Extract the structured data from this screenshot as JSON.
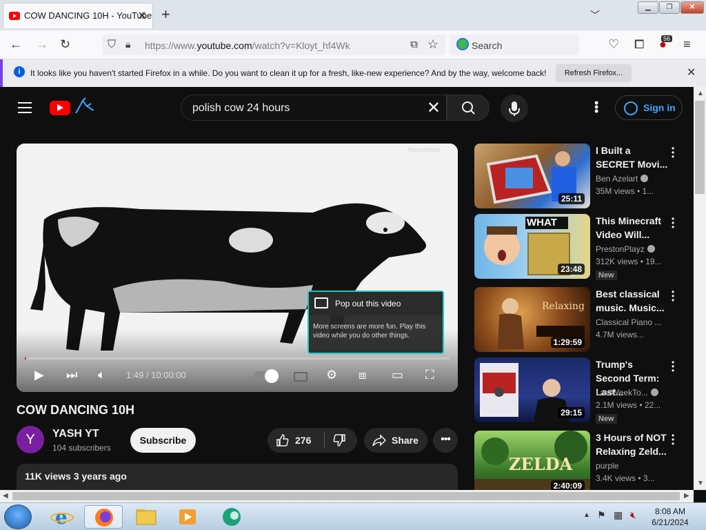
{
  "browser": {
    "tab_title": "COW DANCING 10H - YouTube",
    "url_domain_prefix": "https://www.",
    "url_domain": "youtube.com",
    "url_path": "/watch?v=Kloyt_hf4Wk",
    "search_placeholder": "Search",
    "extension_badge": "56"
  },
  "notification": {
    "message": "It looks like you haven't started Firefox in a while. Do you want to clean it up for a fresh, like-new experience? And by the way, welcome back!",
    "button": "Refresh Firefox..."
  },
  "youtube": {
    "search_query": "polish cow 24 hours",
    "signin_label": "Sign in",
    "player": {
      "time": "1:49 / 10:00:00",
      "progress": 0.003,
      "watermark": "HoursHood",
      "popout_title": "Pop out this video",
      "popout_desc": "More screens are more fun. Play this video while you do other things."
    },
    "video": {
      "title": "COW DANCING 10H",
      "channel_initial": "Y",
      "channel": "YASH YT",
      "subscribers": "104 subscribers",
      "subscribe": "Subscribe",
      "likes": "276",
      "share": "Share",
      "meta": "11K views  3 years ago"
    },
    "recommendations": [
      {
        "title": "I Built a SECRET Movi...",
        "channel": "Ben Azelart",
        "verified": true,
        "views": "35M views  • 1...",
        "duration": "25:11",
        "badge": ""
      },
      {
        "title": "This Minecraft Video Will...",
        "channel": "PrestonPlayz",
        "verified": true,
        "views": "312K views  • 19...",
        "duration": "23:48",
        "badge": "New",
        "thumb_text": "WHAT"
      },
      {
        "title": "Best classical music. Music...",
        "channel": "Classical Piano ...",
        "verified": false,
        "views": "4.7M views...",
        "duration": "1:29:59",
        "badge": "",
        "thumb_text": "Relaxing"
      },
      {
        "title": "Trump's Second Term: Last...",
        "channel": "LastWeekTo...",
        "verified": true,
        "views": "2.1M views  • 22...",
        "duration": "29:15",
        "badge": "New"
      },
      {
        "title": "3 Hours of NOT Relaxing Zeld...",
        "channel": "purple",
        "verified": false,
        "views": "3.4K views  • 3...",
        "duration": "2:40:09",
        "badge": "",
        "thumb_text": "ZELDA"
      }
    ]
  },
  "taskbar": {
    "time": "8:08 AM",
    "date": "6/21/2024"
  }
}
